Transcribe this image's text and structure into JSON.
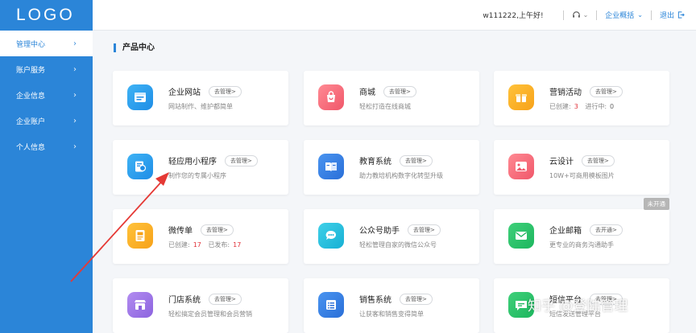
{
  "sidebar": {
    "logo": "LOGO",
    "items": [
      {
        "label": "管理中心",
        "active": true
      },
      {
        "label": "账户服务"
      },
      {
        "label": "企业信息"
      },
      {
        "label": "企业账户"
      },
      {
        "label": "个人信息"
      }
    ]
  },
  "header": {
    "greeting": "w111222,上午好!",
    "overview": "企业概括",
    "logout": "退出"
  },
  "section_title": "产品中心",
  "cards": [
    {
      "title": "企业网站",
      "button": "去管理>",
      "desc": "网站制作、维护都简单"
    },
    {
      "title": "商城",
      "button": "去管理>",
      "desc": "轻松打造在线商城"
    },
    {
      "title": "营销活动",
      "button": "去管理>",
      "stat1_label": "已创建:",
      "stat1_value": "3",
      "stat2_label": "进行中:",
      "stat2_value": "0"
    },
    {
      "title": "轻应用小程序",
      "button": "去管理>",
      "desc": "制作您的专属小程序"
    },
    {
      "title": "教育系统",
      "button": "去管理>",
      "desc": "助力教培机构数字化转型升级"
    },
    {
      "title": "云设计",
      "button": "去管理>",
      "desc": "10W+可商用模板图片"
    },
    {
      "title": "微传单",
      "button": "去管理>",
      "stat1_label": "已创建:",
      "stat1_value": "17",
      "stat2_label": "已发布:",
      "stat2_value": "17"
    },
    {
      "title": "公众号助手",
      "button": "去管理>",
      "desc": "轻松管理自家的微信公众号"
    },
    {
      "title": "企业邮箱",
      "button": "去开通>",
      "desc": "更专业的商务沟通助手",
      "badge": "未开通"
    },
    {
      "title": "门店系统",
      "button": "去管理>",
      "desc": "轻松搞定会员管理和会员营销"
    },
    {
      "title": "销售系统",
      "button": "去管理>",
      "desc": "让获客和销售变得简单"
    },
    {
      "title": "短信平台",
      "button": "去管理>",
      "desc": "短信发送管理平台"
    }
  ],
  "watermark": "知乎 @登陆管理",
  "colors": {
    "primary": "#2b85d8",
    "accent_red": "#e0323a"
  }
}
